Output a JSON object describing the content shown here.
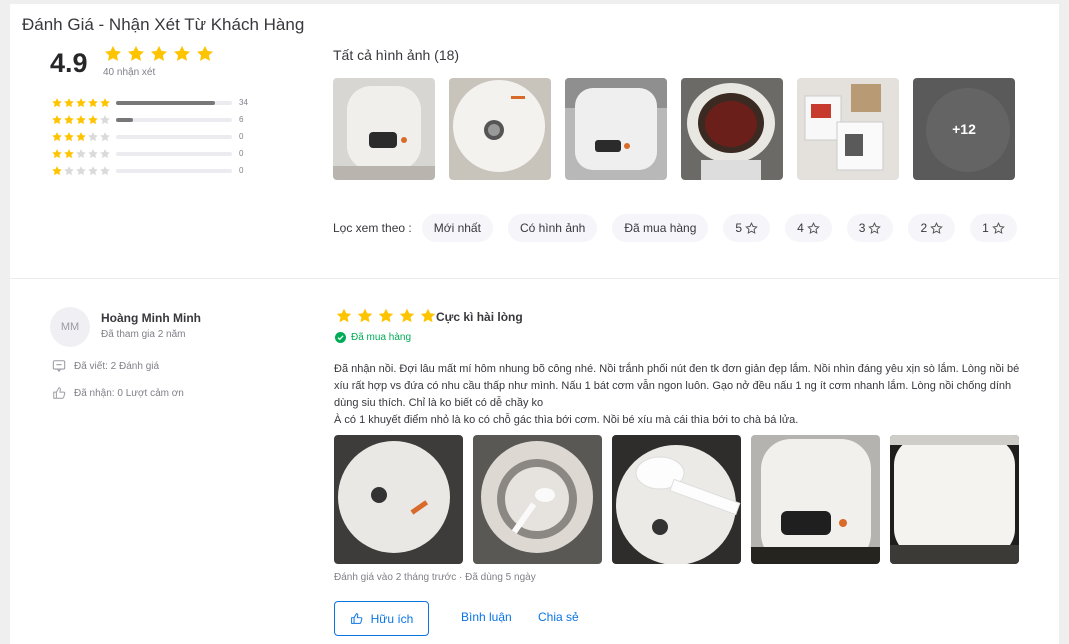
{
  "section": {
    "title": "Đánh Giá - Nhận Xét Từ Khách Hàng"
  },
  "summary": {
    "average": "4.9",
    "rating_value": 4.9,
    "review_count_text": "40 nhận xét",
    "distribution": [
      {
        "stars": 5,
        "count": "34",
        "fraction": 0.85
      },
      {
        "stars": 4,
        "count": "6",
        "fraction": 0.15
      },
      {
        "stars": 3,
        "count": "0",
        "fraction": 0
      },
      {
        "stars": 2,
        "count": "0",
        "fraction": 0
      },
      {
        "stars": 1,
        "count": "0",
        "fraction": 0
      }
    ]
  },
  "gallery": {
    "title": "Tất cả hình ảnh (18)",
    "more_label": "+12",
    "thumbs": [
      "cooker-front-photo",
      "cooker-top-photo",
      "cooker-angle-photo",
      "cooker-inner-pot-photo",
      "unboxing-photo",
      "more-photos"
    ]
  },
  "filter": {
    "label": "Lọc xem theo :",
    "chips": [
      "Mới nhất",
      "Có hình ảnh",
      "Đã mua hàng"
    ],
    "star_chips": [
      "5",
      "4",
      "3",
      "2",
      "1"
    ]
  },
  "review": {
    "avatar_initials": "MM",
    "name": "Hoàng Minh Minh",
    "joined": "Đã tham gia 2 năm",
    "written": "Đã viết: 2 Đánh giá",
    "thanks": "Đã nhận: 0 Lượt cảm ơn",
    "rating": 5,
    "headline": "Cực kì hài lòng",
    "bought": "Đã mua hàng",
    "body_lines": [
      "Đã nhận nồi. Đợi lâu mất mí hôm nhung bõ công nhé. Nồi trắnh phối nút đen tk đơn giản đẹp lắm. Nồi nhìn đáng yêu xịn sò lắm. Lòng nồi bé",
      "xíu rất hợp vs đứa có nhu cầu thấp như mình. Nấu 1 bát cơm vẫn ngon luôn. Gạo nở đều nấu 1 ng ít cơm nhanh lắm. Lòng nồi chống dính",
      "dùng siu thích. Chỉ là ko biết có dễ chầy ko",
      "À có 1 khuyết điểm nhỏ là ko có chỗ gác thìa bới cơm. Nồi bé xíu mà cái thìa bới to chà bá lửa."
    ],
    "photos": [
      "lid-photo",
      "open-pot-photo",
      "spoon-photo",
      "control-panel-photo",
      "side-view-photo"
    ],
    "date": "Đánh giá vào 2 tháng trước · Đã dùng 5 ngày",
    "helpful_label": "Hữu ích",
    "comment_label": "Bình luận",
    "share_label": "Chia sẻ"
  },
  "colors": {
    "star": "#ffc400",
    "star_empty": "#dadada",
    "accent": "#0b74e5",
    "green": "#00ab56"
  }
}
